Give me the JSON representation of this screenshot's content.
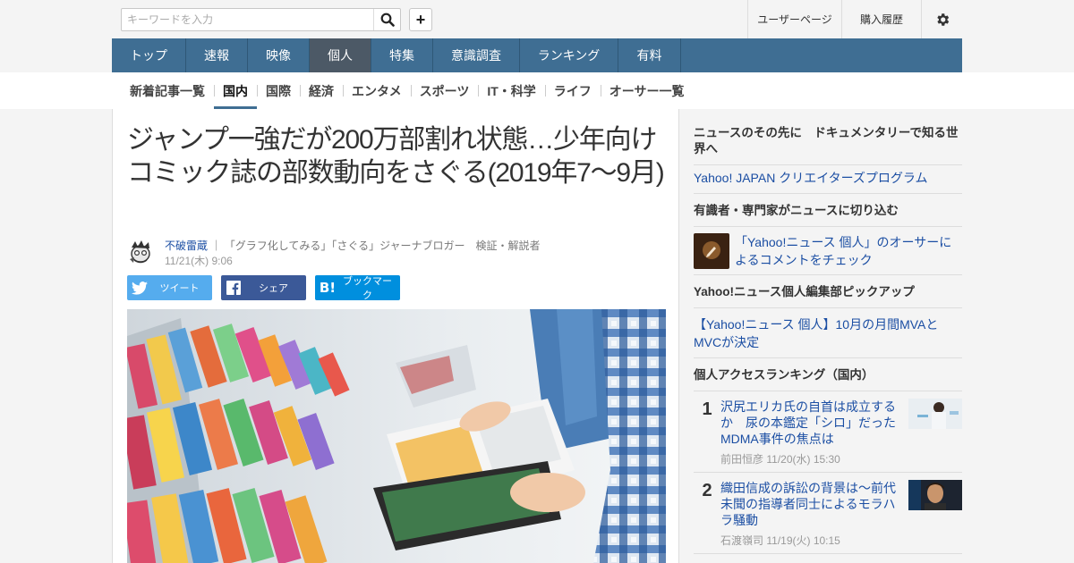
{
  "search": {
    "placeholder": "キーワードを入力"
  },
  "header": {
    "user_page": "ユーザーページ",
    "purchase_history": "購入履歴"
  },
  "main_nav": [
    {
      "label": "トップ"
    },
    {
      "label": "速報"
    },
    {
      "label": "映像"
    },
    {
      "label": "個人",
      "active": true
    },
    {
      "label": "特集"
    },
    {
      "label": "意識調査"
    },
    {
      "label": "ランキング"
    },
    {
      "label": "有料"
    }
  ],
  "sub_nav": [
    {
      "label": "新着記事一覧"
    },
    {
      "label": "国内",
      "active": true
    },
    {
      "label": "国際"
    },
    {
      "label": "経済"
    },
    {
      "label": "エンタメ"
    },
    {
      "label": "スポーツ"
    },
    {
      "label": "IT・科学"
    },
    {
      "label": "ライフ"
    },
    {
      "label": "オーサー一覧"
    }
  ],
  "article": {
    "title": "ジャンプ一強だが200万部割れ状態…少年向けコミック誌の部数動向をさぐる(2019年7～9月)",
    "author_name": "不破雷蔵",
    "author_desc": "「グラフ化してみる」「さぐる」ジャーナブロガー　検証・解説者",
    "date": "11/21(木) 9:06",
    "share": {
      "twitter": "ツイート",
      "facebook": "シェア",
      "hatena": "ブックマーク"
    }
  },
  "sidebar": {
    "promo_heading": "ニュースのその先に　ドキュメンタリーで知る世界へ",
    "promo_link": "Yahoo! JAPAN クリエイターズプログラム",
    "expert_heading": "有識者・専門家がニュースに切り込む",
    "expert_link": "「Yahoo!ニュース 個人」のオーサーによるコメントをチェック",
    "pickup_heading": "Yahoo!ニュース個人編集部ピックアップ",
    "pickup_link": "【Yahoo!ニュース 個人】10月の月間MVAとMVCが決定",
    "ranking_heading": "個人アクセスランキング（国内）",
    "ranking": [
      {
        "rank": "1",
        "title": "沢尻エリカ氏の自首は成立するか　尿の本鑑定「シロ」だったMDMA事件の焦点は",
        "author": "前田恒彦",
        "date": "11/20(水) 15:30"
      },
      {
        "rank": "2",
        "title": "織田信成の訴訟の背景は～前代未聞の指導者同士によるモラハラ騒動",
        "author": "石渡嶺司",
        "date": "11/19(火) 10:15"
      }
    ]
  }
}
